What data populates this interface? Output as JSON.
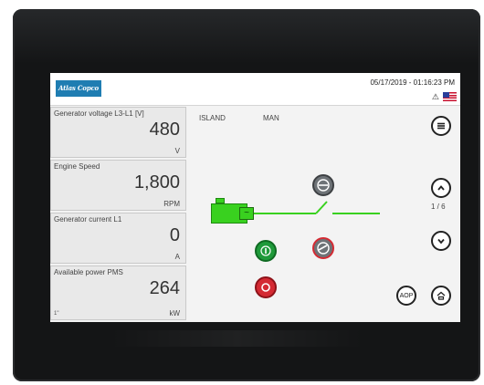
{
  "header": {
    "logo_text": "Atlas Copco",
    "datetime": "05/17/2019 - 01:16:23 PM",
    "warning_icon": "warning-triangle-icon",
    "flag_icon": "us-flag-icon"
  },
  "tiles": [
    {
      "label": "Generator voltage L3-L1 [V]",
      "value": "480",
      "unit": "V",
      "note": ""
    },
    {
      "label": "Engine Speed",
      "value": "1,800",
      "unit": "RPM",
      "note": ""
    },
    {
      "label": "Generator current L1",
      "value": "0",
      "unit": "A",
      "note": ""
    },
    {
      "label": "Available power PMS",
      "value": "264",
      "unit": "kW",
      "note": "1\""
    }
  ],
  "diagram": {
    "mode_left": "ISLAND",
    "mode_right": "MAN",
    "page_indicator": "1 / 6",
    "aop_label": "AOP"
  },
  "colors": {
    "gen_green": "#39d11f",
    "start_green": "#1f9a3a",
    "stop_red": "#d42a33",
    "breaker_gray": "#6e7377"
  }
}
